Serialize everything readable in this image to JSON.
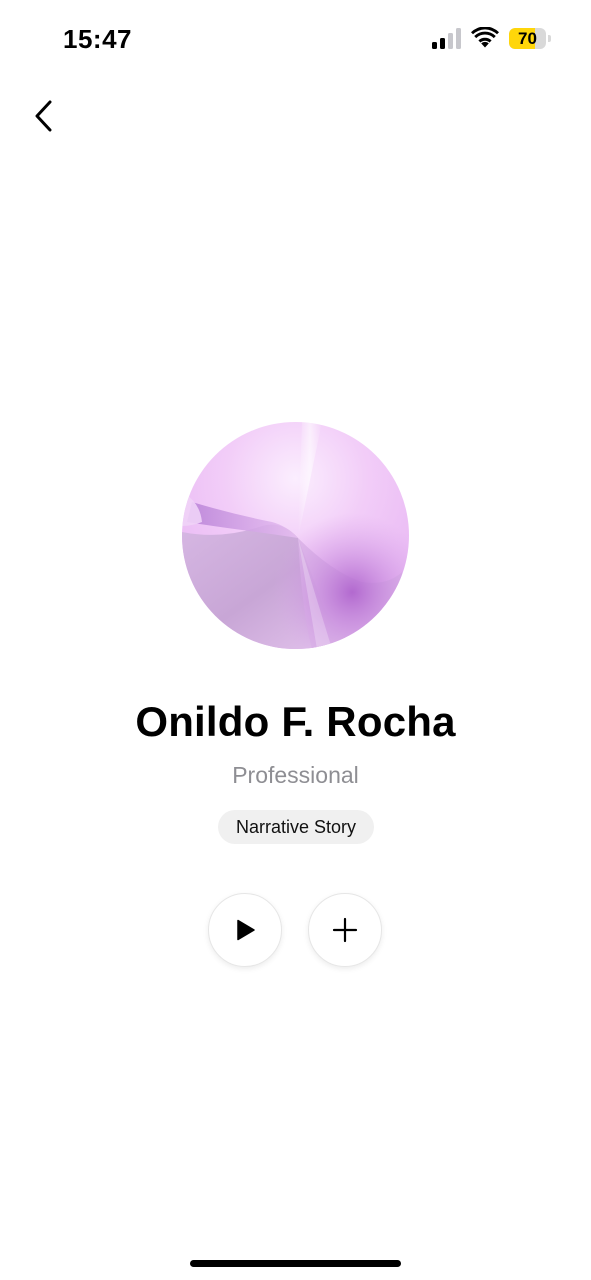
{
  "status_bar": {
    "time": "15:47",
    "battery_level": "70",
    "battery_fraction": 0.7,
    "battery_color": "#ffd60a",
    "signal_icon": "cellular-signal-icon",
    "wifi_icon": "wifi-icon"
  },
  "nav": {
    "back_icon": "chevron-left-icon"
  },
  "profile": {
    "name": "Onildo F. Rocha",
    "role": "Professional",
    "tag": "Narrative Story"
  },
  "actions": {
    "play_icon": "play-icon",
    "add_icon": "plus-icon"
  },
  "colors": {
    "secondary_text": "#8e8e93",
    "tag_background": "#f0f0f0",
    "avatar_accent": "#c36be0"
  }
}
